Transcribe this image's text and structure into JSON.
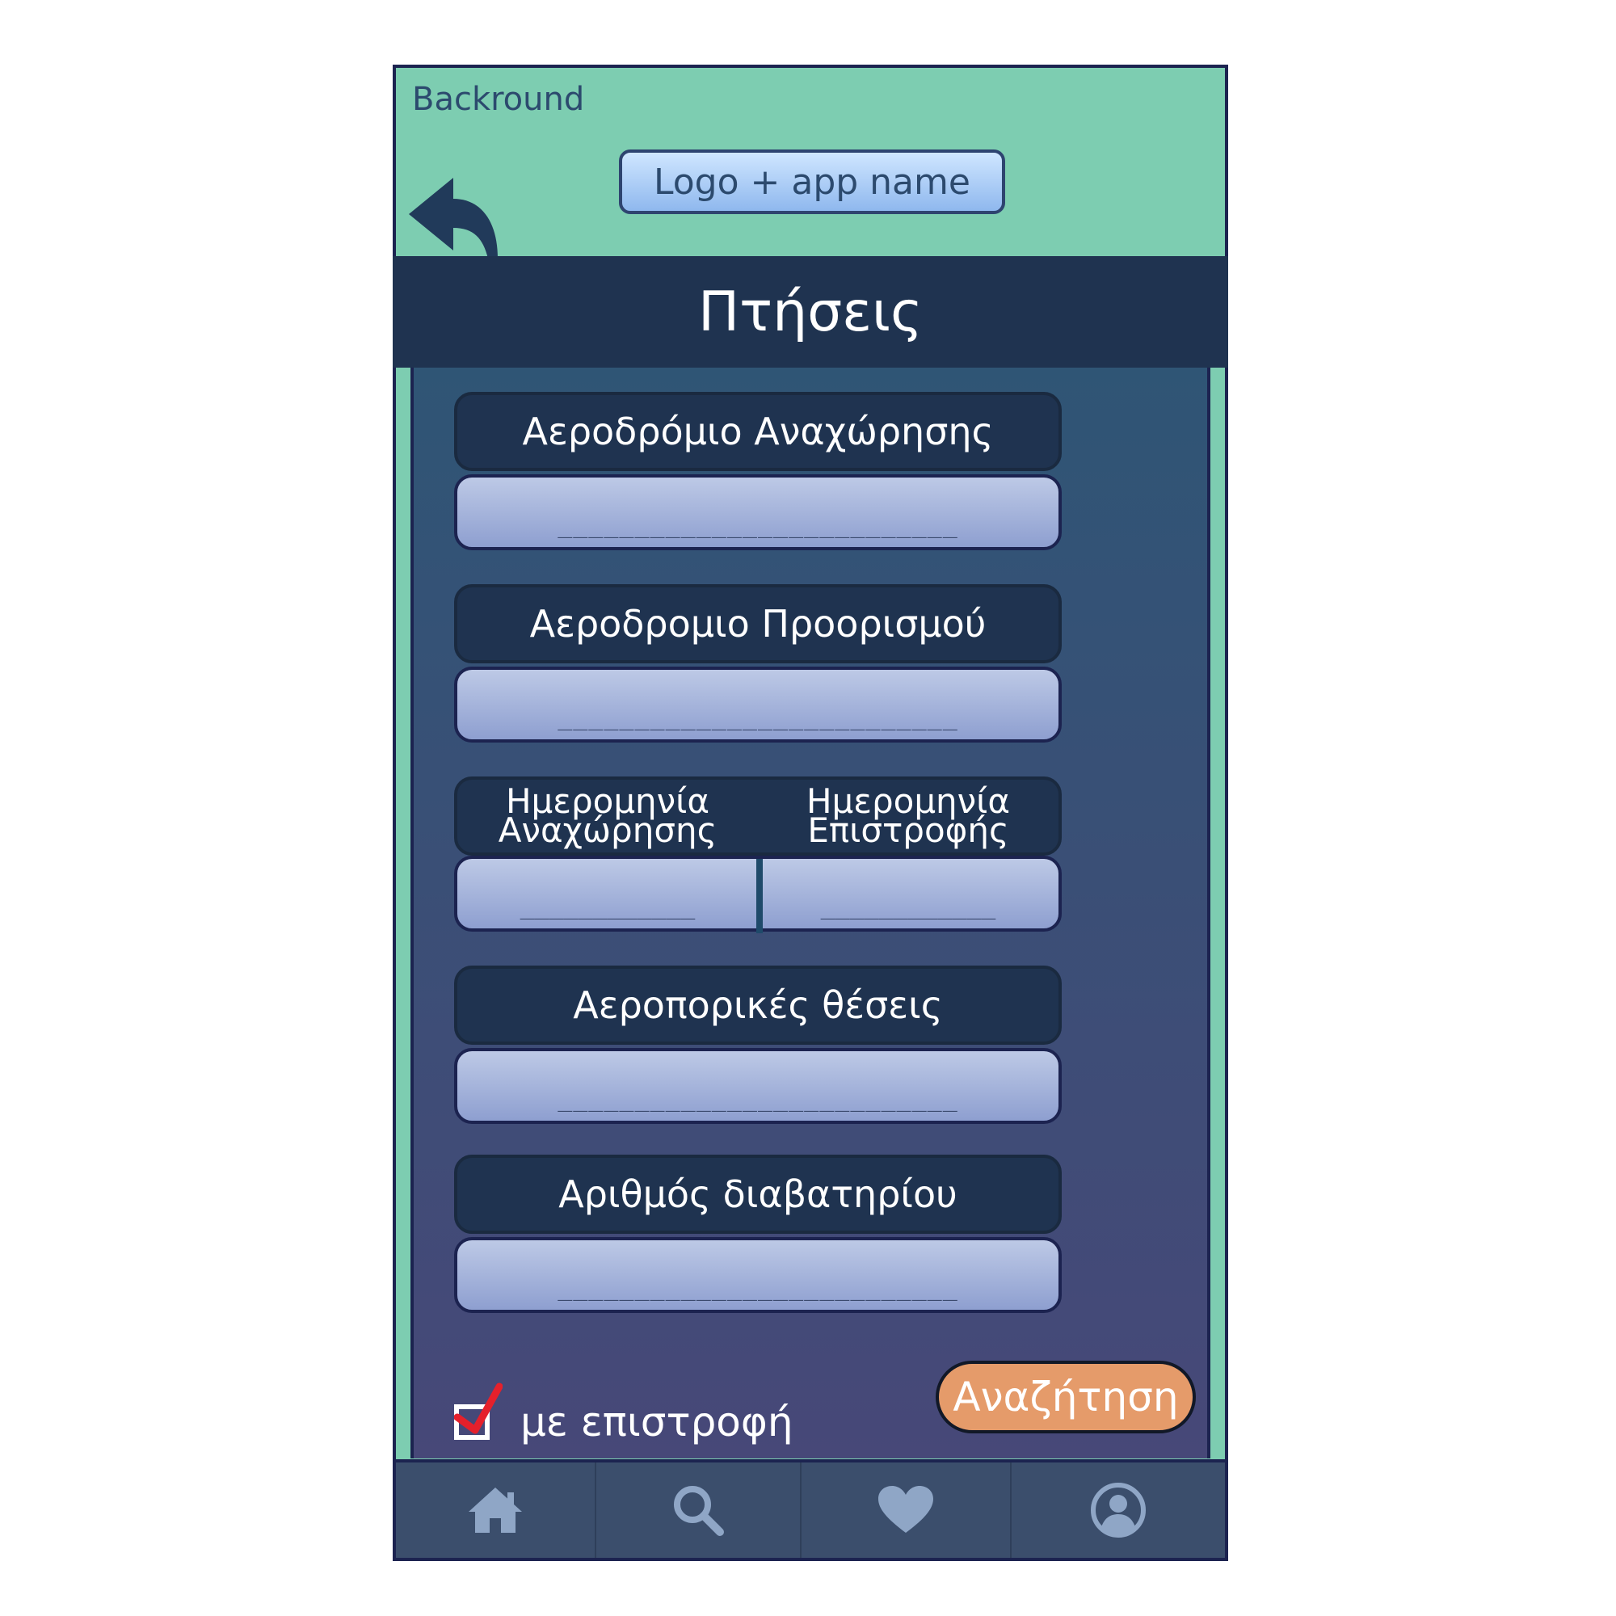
{
  "background_label": "Backround",
  "header": {
    "logo_text": "Logo + app name",
    "back_icon": "back-arrow-icon"
  },
  "title": "Πτήσεις",
  "fields": {
    "departure_airport": {
      "label": "Αεροδρόμιο Αναχώρησης",
      "placeholder": "__________________________"
    },
    "destination_airport": {
      "label": "Αεροδρομιο Προορισμού",
      "placeholder": "__________________________"
    },
    "dates": {
      "departure_line1": "Ημερομηνία",
      "departure_line2": "Αναχώρησης",
      "return_line1": "Ημερομηνία",
      "return_line2": "Επιστροφής",
      "departure_placeholder": "____________",
      "return_placeholder": "____________"
    },
    "seats": {
      "label": "Αεροπορικές θέσεις",
      "placeholder": "__________________________"
    },
    "passport": {
      "label": "Αριθμός διαβατηρίου",
      "placeholder": "__________________________"
    }
  },
  "return_checkbox": {
    "label": "με επιστροφή",
    "checked": true
  },
  "search_button": "Αναζήτηση",
  "nav": [
    "home-icon",
    "search-icon",
    "heart-icon",
    "profile-icon"
  ],
  "colors": {
    "header_bg": "#7dcdb1",
    "title_bar": "#1f3350",
    "button": "#e59b6a",
    "nav_bg": "#3b4e6c",
    "nav_icon": "#8fa6c6",
    "check_mark": "#e5202b"
  }
}
